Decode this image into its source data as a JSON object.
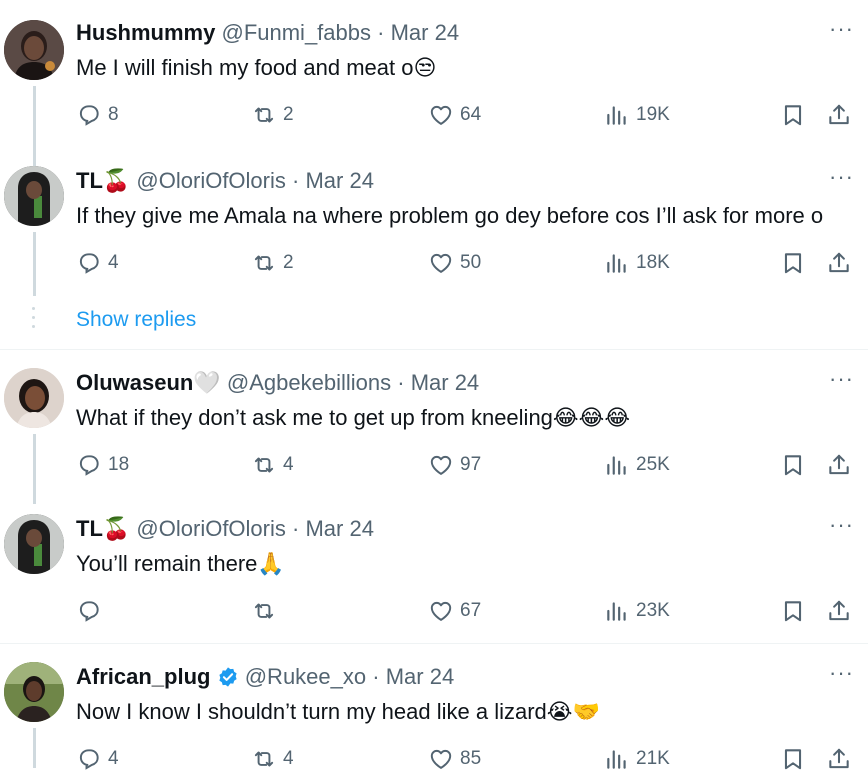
{
  "tweets": [
    {
      "name": "Hushmummy",
      "name_emoji": "",
      "verified": false,
      "handle": "@Funmi_fabbs",
      "sep": "·",
      "date": "Mar 24",
      "text": "Me I will finish my food and meat o",
      "text_emoji": "😒",
      "replies": "8",
      "retweets": "2",
      "likes": "64",
      "views": "19K"
    },
    {
      "name": "TL",
      "name_emoji": "🍒",
      "verified": false,
      "handle": "@OloriOfOloris",
      "sep": "·",
      "date": "Mar 24",
      "text": "If they give me Amala na where problem go dey before cos I’ll ask for more o",
      "text_emoji": "",
      "replies": "4",
      "retweets": "2",
      "likes": "50",
      "views": "18K"
    },
    {
      "name": "Oluwaseun",
      "name_emoji": "🤍",
      "verified": false,
      "handle": "@Agbekebillions",
      "sep": "·",
      "date": "Mar 24",
      "text": "What if they don’t ask me to get up from kneeling",
      "text_emoji": "😂😂😂",
      "replies": "18",
      "retweets": "4",
      "likes": "97",
      "views": "25K"
    },
    {
      "name": "TL",
      "name_emoji": "🍒",
      "verified": false,
      "handle": "@OloriOfOloris",
      "sep": "·",
      "date": "Mar 24",
      "text": "You’ll remain there",
      "text_emoji": "🙏",
      "replies": "",
      "retweets": "",
      "likes": "67",
      "views": "23K"
    },
    {
      "name": "African_plug",
      "name_emoji": "",
      "verified": true,
      "handle": "@Rukee_xo",
      "sep": "·",
      "date": "Mar 24",
      "text": "Now I know I shouldn’t turn my head like a lizard",
      "text_emoji": "😭🤝",
      "replies": "4",
      "retweets": "4",
      "likes": "85",
      "views": "21K"
    }
  ],
  "show_replies": "Show replies",
  "more_icon": "···",
  "colors": {
    "link": "#1d9bf0",
    "muted": "#536471",
    "text": "#0f1419",
    "verified": "#1d9bf0",
    "line": "#cfd9de"
  }
}
